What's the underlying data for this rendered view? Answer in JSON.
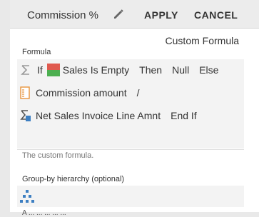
{
  "header": {
    "title": "Commission %",
    "apply_label": "APPLY",
    "cancel_label": "CANCEL"
  },
  "editor": {
    "mode_label": "Custom Formula",
    "formula_label": "Formula",
    "lines": [
      {
        "icon": "sigma-icon",
        "tokens": [
          "If",
          "Sales Is Empty",
          "Then",
          "Null",
          "Else"
        ]
      },
      {
        "icon": "list-icon",
        "tokens": [
          "Commission amount",
          "/"
        ]
      },
      {
        "icon": "sigma-list-icon",
        "tokens": [
          "Net Sales Invoice Line Amnt",
          "End If"
        ]
      }
    ],
    "hint": "The custom formula.",
    "groupby_label": "Group-by hierarchy (optional)",
    "groupby_icon": "hierarchy-icon",
    "cutoff_text": "A ... ... ... ... ..."
  },
  "colors": {
    "accent_blue": "#3d7fc2",
    "flag_red": "#e05a4f",
    "flag_green": "#4caf50",
    "list_orange": "#e8943a"
  }
}
